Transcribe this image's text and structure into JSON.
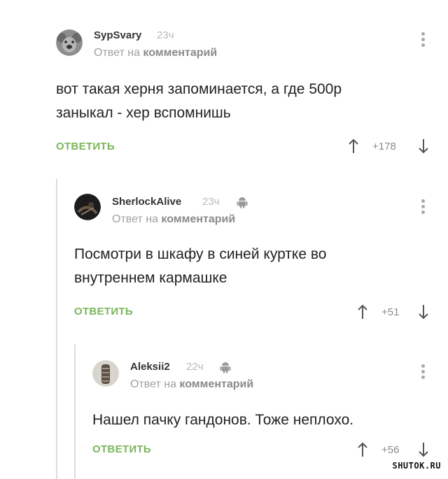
{
  "comments": [
    {
      "author": "SypSvary",
      "time": "23ч",
      "reply_prefix": "Ответ на ",
      "reply_target": "комментарий",
      "text_lines": [
        "вот такая херня запоминается, а где 500р",
        "заныкал - хер вспомнишь"
      ],
      "reply_label": "ОТВЕТИТЬ",
      "score": "+178",
      "android": false
    },
    {
      "author": "SherlockAlive",
      "time": "23ч",
      "reply_prefix": "Ответ на ",
      "reply_target": "комментарий",
      "text_lines": [
        "Посмотри в шкафу в синей куртке во",
        "внутреннем кармашке"
      ],
      "reply_label": "ОТВЕТИТЬ",
      "score": "+51",
      "android": true
    },
    {
      "author": "Aleksii2",
      "time": "22ч",
      "reply_prefix": "Ответ на ",
      "reply_target": "комментарий",
      "text_lines": [
        "Нашел пачку гандонов. Тоже неплохо."
      ],
      "reply_label": "ОТВЕТИТЬ",
      "score": "+56",
      "android": true
    }
  ],
  "watermark": "SHUTOK.RU",
  "colors": {
    "accent": "#7ab65b",
    "muted": "#a0a0a0",
    "thread": "#dcdcdc"
  }
}
